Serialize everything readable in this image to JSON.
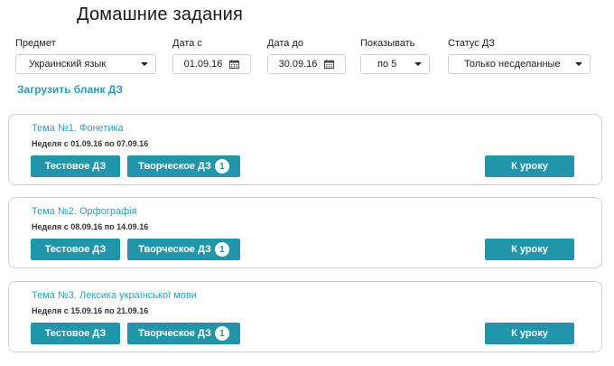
{
  "page": {
    "title": "Домашние задания"
  },
  "filters": {
    "subject": {
      "label": "Предмет",
      "value": "Украинский язык"
    },
    "date_from": {
      "label": "Дата с",
      "value": "01.09.16"
    },
    "date_to": {
      "label": "Дата до",
      "value": "30.09.16"
    },
    "show": {
      "label": "Показывать",
      "value": "по 5"
    },
    "status": {
      "label": "Статус ДЗ",
      "value": "Только несделанные"
    }
  },
  "upload_link": "Загрузить бланк ДЗ",
  "topics": [
    {
      "title": "Тема №1. Фонетика",
      "week": "Неделя с 01.09.16 по 07.09.16",
      "test_label": "Тестовое ДЗ",
      "creative_label": "Творческое ДЗ",
      "creative_count": "1",
      "lesson_label": "К уроку"
    },
    {
      "title": "Тема №2. Орфографія",
      "week": "Неделя с 08.09.16 по 14.09.16",
      "test_label": "Тестовое ДЗ",
      "creative_label": "Творческое ДЗ",
      "creative_count": "1",
      "lesson_label": "К уроку"
    },
    {
      "title": "Тема №3. Лексика української мови",
      "week": "Неделя с 15.09.16 по 21.09.16",
      "test_label": "Тестовое ДЗ",
      "creative_label": "Творческое ДЗ",
      "creative_count": "1",
      "lesson_label": "К уроку"
    }
  ]
}
